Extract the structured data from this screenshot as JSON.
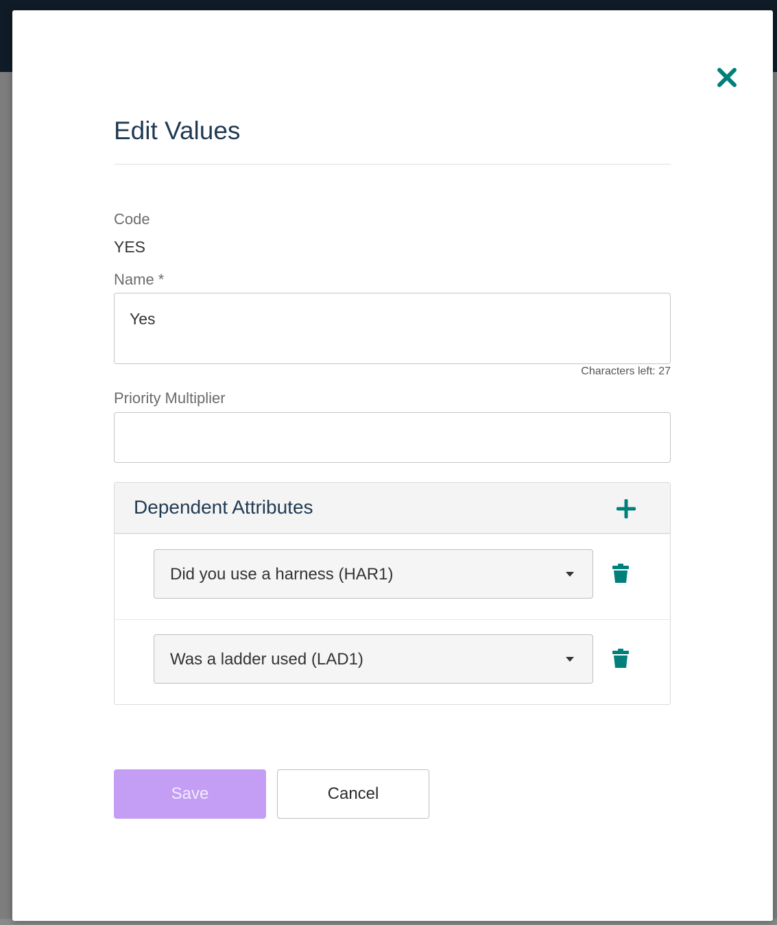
{
  "modal": {
    "title": "Edit Values",
    "close_icon": "close-x-icon"
  },
  "code": {
    "label": "Code",
    "value": "YES"
  },
  "name": {
    "label": "Name *",
    "value": "Yes",
    "chars_left": "Characters left: 27"
  },
  "priority": {
    "label": "Priority Multiplier",
    "value": ""
  },
  "dependent": {
    "title": "Dependent Attributes",
    "add_icon": "plus-icon",
    "items": [
      {
        "label": "Did you use a harness (HAR1)"
      },
      {
        "label": "Was a ladder used (LAD1)"
      }
    ]
  },
  "actions": {
    "save_label": "Save",
    "cancel_label": "Cancel"
  },
  "colors": {
    "accent": "#007f7b",
    "title": "#1f3a52",
    "save_bg": "#c39ef4"
  }
}
